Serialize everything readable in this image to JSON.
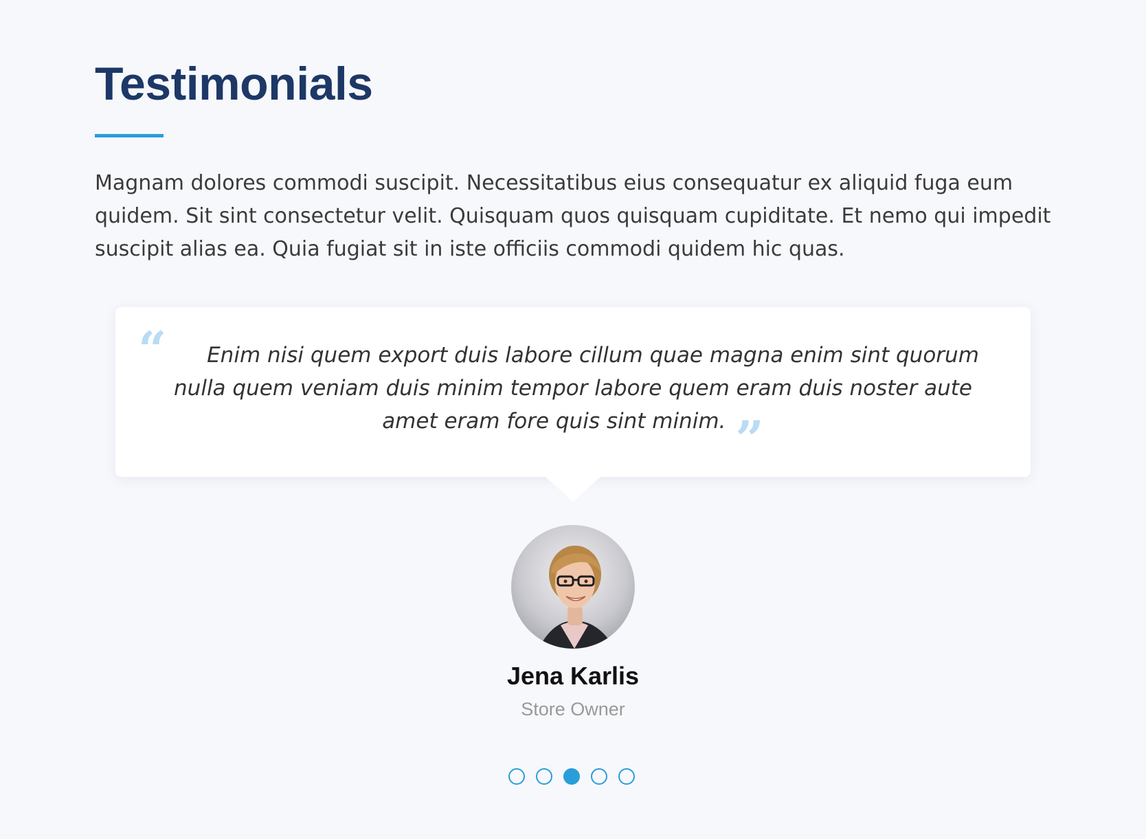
{
  "section": {
    "title": "Testimonials",
    "intro": "Magnam dolores commodi suscipit. Necessitatibus eius consequatur ex aliquid fuga eum quidem. Sit sint consectetur velit. Quisquam quos quisquam cupiditate. Et nemo qui impedit suscipit alias ea. Quia fugiat sit in iste officiis commodi quidem hic quas."
  },
  "testimonial": {
    "quote": "Enim nisi quem export duis labore cillum quae magna enim sint quorum nulla quem veniam duis minim tempor labore quem eram duis noster aute amet eram fore quis sint minim.",
    "open_quote_mark": "“",
    "close_quote_mark": "”",
    "author_name": "Jena Karlis",
    "author_role": "Store Owner"
  },
  "pager": {
    "total": 5,
    "active_index": 2
  },
  "colors": {
    "accent": "#2a9ed8",
    "title": "#1d3866",
    "background": "#f7f8fc",
    "quote_mark": "#b9dcf4"
  }
}
